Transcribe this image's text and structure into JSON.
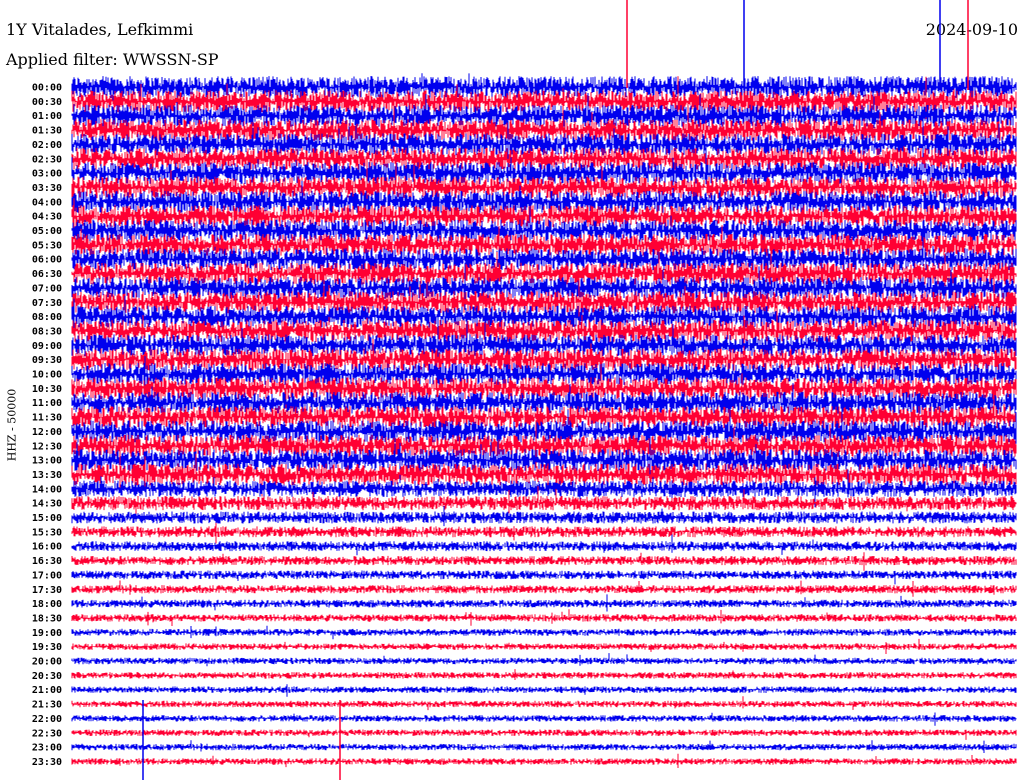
{
  "header": {
    "title": "1Y Vitalades, Lefkimmi",
    "date": "2024-09-10",
    "filter": "Applied filter: WWSSN-SP"
  },
  "chart_data": {
    "type": "line",
    "title": "1Y Vitalades, Lefkimmi",
    "ylabel": "HHZ - 50000",
    "rows": [
      "00:00",
      "00:30",
      "01:00",
      "01:30",
      "02:00",
      "02:30",
      "03:00",
      "03:30",
      "04:00",
      "04:30",
      "05:00",
      "05:30",
      "06:00",
      "06:30",
      "07:00",
      "07:30",
      "08:00",
      "08:30",
      "09:00",
      "09:30",
      "10:00",
      "10:30",
      "11:00",
      "11:30",
      "12:00",
      "12:30",
      "13:00",
      "13:30",
      "14:00",
      "14:30",
      "15:00",
      "15:30",
      "16:00",
      "16:30",
      "17:00",
      "17:30",
      "18:00",
      "18:30",
      "19:00",
      "19:30",
      "20:00",
      "20:30",
      "21:00",
      "21:30",
      "22:00",
      "22:30",
      "23:00",
      "23:30"
    ],
    "series_colors": [
      "#0000ee",
      "#ff0033"
    ],
    "row_amplitude_relative": [
      1.0,
      1.0,
      1.0,
      1.0,
      1.0,
      1.0,
      1.0,
      1.0,
      1.0,
      1.0,
      1.0,
      1.0,
      1.0,
      1.0,
      1.0,
      1.0,
      1.0,
      1.0,
      1.0,
      1.0,
      1.0,
      1.0,
      1.0,
      1.0,
      1.0,
      1.0,
      1.0,
      1.0,
      0.75,
      0.65,
      0.55,
      0.5,
      0.45,
      0.42,
      0.4,
      0.38,
      0.36,
      0.34,
      0.32,
      0.3,
      0.3,
      0.3,
      0.3,
      0.3,
      0.3,
      0.3,
      0.3,
      0.3
    ],
    "grid": false
  }
}
